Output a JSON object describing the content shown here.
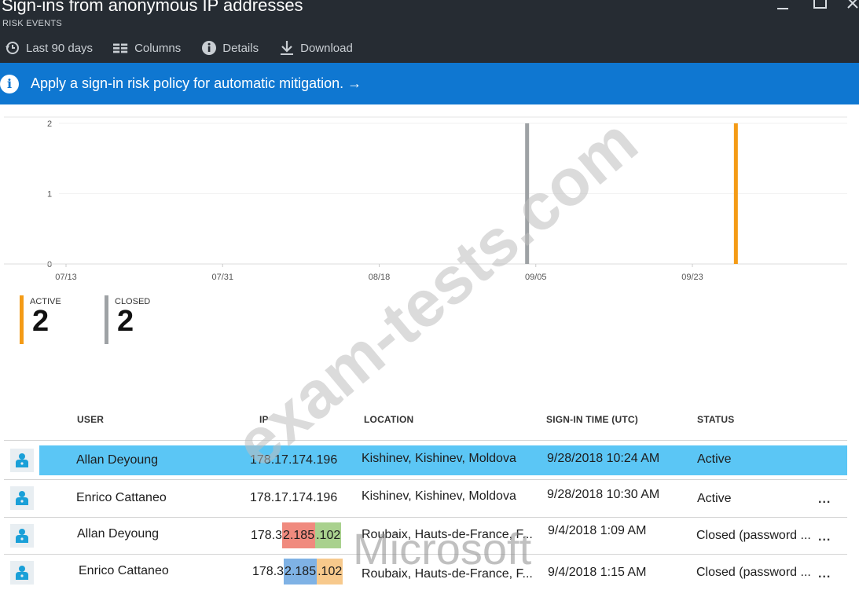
{
  "header": {
    "title": "Sign-ins from anonymous IP addresses",
    "subtitle": "RISK EVENTS",
    "window_controls": [
      "minimize-icon",
      "maximize-icon",
      "close-icon"
    ]
  },
  "toolbar": {
    "items": [
      {
        "icon": "history-clock-icon",
        "label": "Last 90 days"
      },
      {
        "icon": "columns-icon",
        "label": "Columns"
      },
      {
        "icon": "info-icon",
        "label": "Details"
      },
      {
        "icon": "download-icon",
        "label": "Download"
      }
    ]
  },
  "banner": {
    "icon": "info-icon",
    "text": "Apply a sign-in risk policy for automatic mitigation. →",
    "color": "#0f77d1"
  },
  "chart_data": {
    "type": "bar",
    "y_ticks": [
      "2",
      "1",
      "0"
    ],
    "ylim": [
      0,
      2
    ],
    "x_ticks": [
      "07/13",
      "07/31",
      "08/18",
      "09/05",
      "09/23"
    ],
    "grid": true,
    "series": [
      {
        "name": "CLOSED",
        "color": "#9ea2a5",
        "points": [
          {
            "x": "09/04",
            "y": 2
          }
        ]
      },
      {
        "name": "ACTIVE",
        "color": "#f49b16",
        "points": [
          {
            "x": "09/28",
            "y": 2
          }
        ]
      }
    ]
  },
  "stats": {
    "active": {
      "label": "ACTIVE",
      "value": "2",
      "color": "#f49b16"
    },
    "closed": {
      "label": "CLOSED",
      "value": "2",
      "color": "#9ea2a5"
    }
  },
  "table": {
    "headers": {
      "user": "USER",
      "ip": "IP",
      "location": "LOCATION",
      "time": "SIGN-IN TIME (UTC)",
      "status": "STATUS"
    },
    "rows": [
      {
        "user": "Allan Deyoung",
        "ip": "178.17.174.196",
        "location": "Kishinev, Kishinev, Moldova",
        "time": "9/28/2018 10:24 AM",
        "status": "Active",
        "selected": true,
        "more": ""
      },
      {
        "user": "Enrico Cattaneo",
        "ip": "178.17.174.196",
        "location": "Kishinev, Kishinev, Moldova",
        "time": "9/28/2018 10:30 AM",
        "status": "Active",
        "selected": false,
        "more": "..."
      },
      {
        "user": "Allan Deyoung",
        "ip_parts": [
          "178.3",
          "2.185",
          ".102"
        ],
        "location": "Roubaix, Hauts-de-France, F...",
        "time": "9/4/2018 1:09 AM",
        "status": "Closed (password ...",
        "selected": false,
        "more": "..."
      },
      {
        "user": "Enrico Cattaneo",
        "ip_parts": [
          "178.3",
          "2.185",
          ".102"
        ],
        "location": "Roubaix, Hauts-de-France, F...",
        "time": "9/4/2018 1:15 AM",
        "status": "Closed (password ...",
        "selected": false,
        "more": "..."
      }
    ],
    "ip_highlight_colors": {
      "row3": [
        "#f08a7e",
        "#a9d18e"
      ],
      "row4": [
        "#7fb2e5",
        "#f7c98c"
      ]
    }
  },
  "watermarks": {
    "diagonal": "exam-tests.com",
    "brand": "Microsoft"
  }
}
